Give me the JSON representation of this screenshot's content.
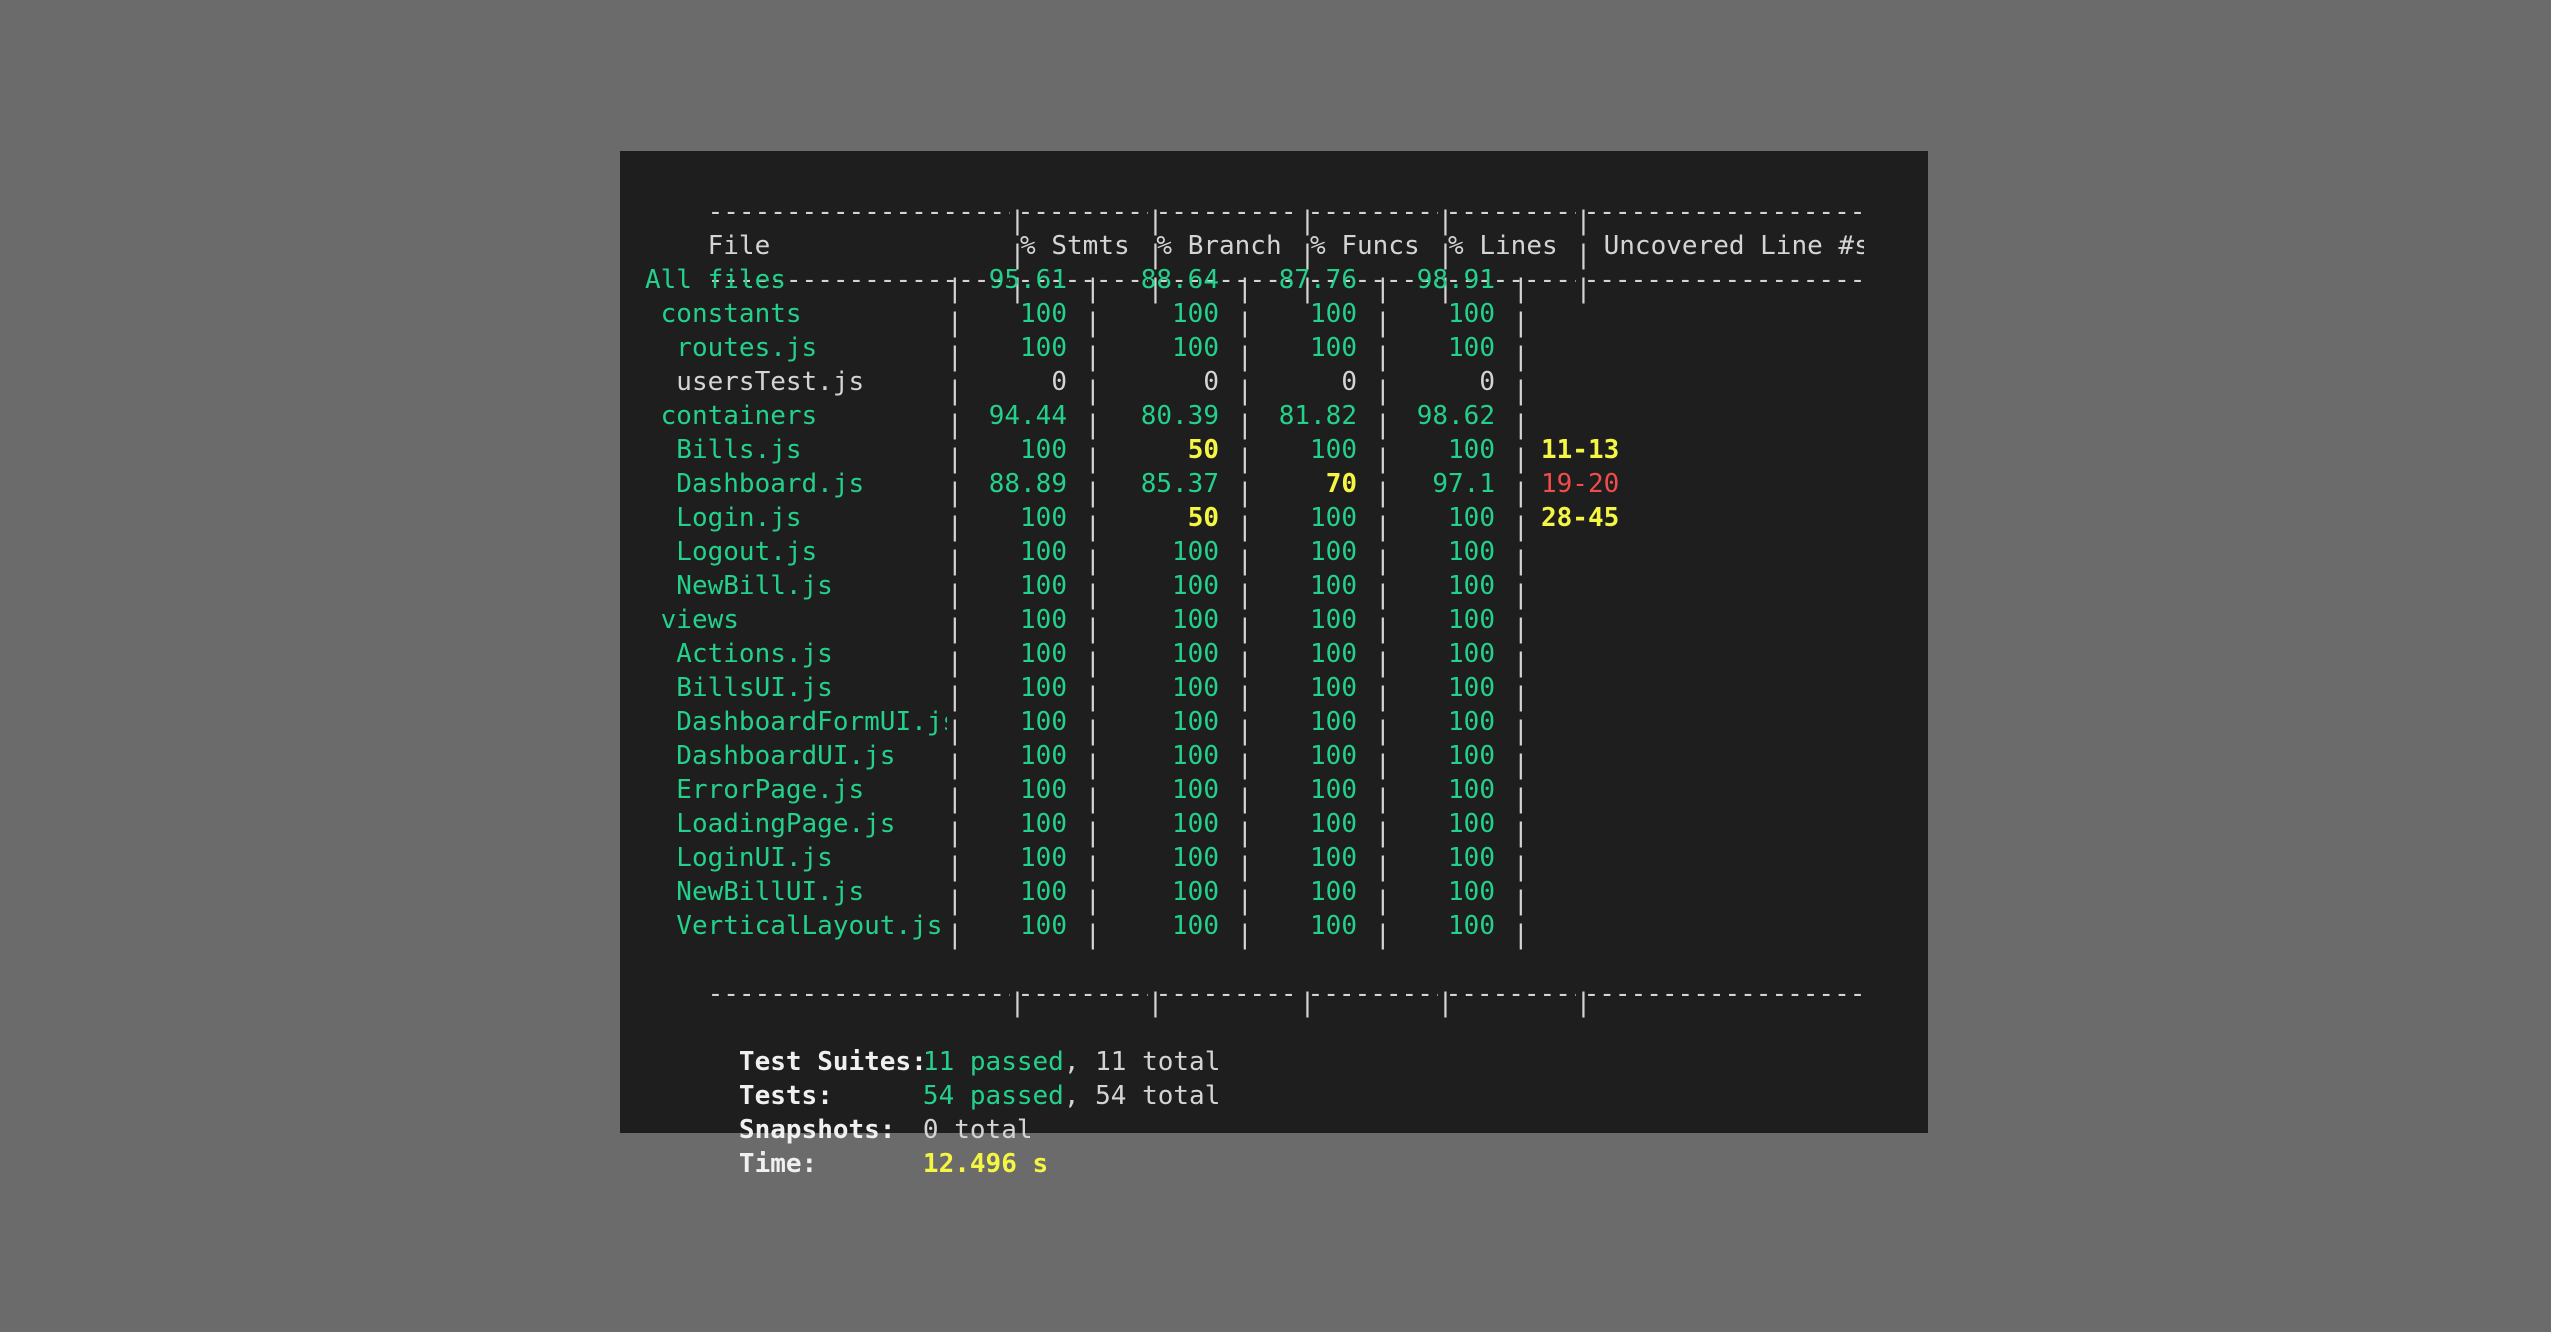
{
  "separator": {
    "file": "--------------------",
    "stmts": "---------",
    "branch": "----------",
    "funcs": "---------",
    "lines": "---------",
    "uncovered": "-------------------"
  },
  "header": {
    "file": "File",
    "stmts": "% Stmts",
    "branch": "% Branch",
    "funcs": "% Funcs",
    "lines": "% Lines",
    "uncovered": "Uncovered Line #s"
  },
  "rows": [
    {
      "file": "All files",
      "stmts": "95.61",
      "branch": "88.64",
      "funcs": "87.76",
      "lines": "98.91",
      "uncovered": ""
    },
    {
      "file": " constants",
      "stmts": "100",
      "branch": "100",
      "funcs": "100",
      "lines": "100",
      "uncovered": ""
    },
    {
      "file": "  routes.js",
      "stmts": "100",
      "branch": "100",
      "funcs": "100",
      "lines": "100",
      "uncovered": ""
    },
    {
      "file": "  usersTest.js",
      "stmts": "0",
      "branch": "0",
      "funcs": "0",
      "lines": "0",
      "uncovered": ""
    },
    {
      "file": " containers",
      "stmts": "94.44",
      "branch": "80.39",
      "funcs": "81.82",
      "lines": "98.62",
      "uncovered": ""
    },
    {
      "file": "  Bills.js",
      "stmts": "100",
      "branch": "50",
      "funcs": "100",
      "lines": "100",
      "uncovered": "11-13"
    },
    {
      "file": "  Dashboard.js",
      "stmts": "88.89",
      "branch": "85.37",
      "funcs": "70",
      "lines": "97.1",
      "uncovered": "19-20"
    },
    {
      "file": "  Login.js",
      "stmts": "100",
      "branch": "50",
      "funcs": "100",
      "lines": "100",
      "uncovered": "28-45"
    },
    {
      "file": "  Logout.js",
      "stmts": "100",
      "branch": "100",
      "funcs": "100",
      "lines": "100",
      "uncovered": ""
    },
    {
      "file": "  NewBill.js",
      "stmts": "100",
      "branch": "100",
      "funcs": "100",
      "lines": "100",
      "uncovered": ""
    },
    {
      "file": " views",
      "stmts": "100",
      "branch": "100",
      "funcs": "100",
      "lines": "100",
      "uncovered": ""
    },
    {
      "file": "  Actions.js",
      "stmts": "100",
      "branch": "100",
      "funcs": "100",
      "lines": "100",
      "uncovered": ""
    },
    {
      "file": "  BillsUI.js",
      "stmts": "100",
      "branch": "100",
      "funcs": "100",
      "lines": "100",
      "uncovered": ""
    },
    {
      "file": "  DashboardFormUI.js",
      "stmts": "100",
      "branch": "100",
      "funcs": "100",
      "lines": "100",
      "uncovered": ""
    },
    {
      "file": "  DashboardUI.js",
      "stmts": "100",
      "branch": "100",
      "funcs": "100",
      "lines": "100",
      "uncovered": ""
    },
    {
      "file": "  ErrorPage.js",
      "stmts": "100",
      "branch": "100",
      "funcs": "100",
      "lines": "100",
      "uncovered": ""
    },
    {
      "file": "  LoadingPage.js",
      "stmts": "100",
      "branch": "100",
      "funcs": "100",
      "lines": "100",
      "uncovered": ""
    },
    {
      "file": "  LoginUI.js",
      "stmts": "100",
      "branch": "100",
      "funcs": "100",
      "lines": "100",
      "uncovered": ""
    },
    {
      "file": "  NewBillUI.js",
      "stmts": "100",
      "branch": "100",
      "funcs": "100",
      "lines": "100",
      "uncovered": ""
    },
    {
      "file": "  VerticalLayout.js",
      "stmts": "100",
      "branch": "100",
      "funcs": "100",
      "lines": "100",
      "uncovered": ""
    }
  ],
  "summary": {
    "suites": {
      "label": "Test Suites:",
      "passed": "11 passed",
      "total": ", 11 total"
    },
    "tests": {
      "label": "Tests:",
      "passed": "54 passed",
      "total": ", 54 total"
    },
    "snapshots": {
      "label": "Snapshots:",
      "total": "0 total"
    },
    "time": {
      "label": "Time:",
      "value": "12.496 s"
    }
  },
  "colors": {
    "background": "#6b6b6b",
    "terminal": "#1e1e1e",
    "pass": "#23d18b",
    "warn": "#f5f543",
    "fail": "#f14c4c",
    "text": "#d4d4d4"
  }
}
